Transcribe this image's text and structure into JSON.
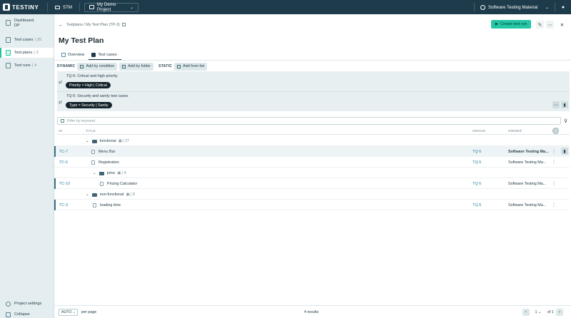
{
  "header": {
    "logo": "TESTINY",
    "workspace": "STM",
    "project": "My Demo Project",
    "organization": "Software Testing Material"
  },
  "sidebar": {
    "items": [
      {
        "label": "Dashboard",
        "sub": "DP",
        "count": ""
      },
      {
        "label": "Test cases",
        "count": "25"
      },
      {
        "label": "Test plans",
        "count": "3"
      },
      {
        "label": "Test runs",
        "count": "4"
      }
    ],
    "project_settings": "Project settings",
    "collapse": "Collapse"
  },
  "breadcrumb": "Testplans / My Test Plan (TP-3)",
  "toolbar": {
    "create_test_run": "Create test run"
  },
  "page_title": "My Test Plan",
  "tabs": [
    {
      "label": "Overview"
    },
    {
      "label": "Test cases"
    }
  ],
  "modes": {
    "dynamic_label": "DYNAMIC",
    "add_by_condition": "Add by condition",
    "add_by_folder": "Add by folder",
    "static_label": "STATIC",
    "add_from_list": "Add from list"
  },
  "conditions": [
    {
      "title": "TQ-5: Critical and high priority",
      "chip": "Priority = High | Critical"
    },
    {
      "title": "TQ-5: Security and sanity test cases",
      "chip": "Type = Security | Sanity"
    }
  ],
  "filter": {
    "placeholder": "Filter by keyword"
  },
  "columns": {
    "id": "ID",
    "title": "TITLE",
    "origin": "ORIGIN",
    "owner": "OWNER"
  },
  "rows": [
    {
      "id": "",
      "title": "functional",
      "count": "27",
      "origin": "",
      "owner": ""
    },
    {
      "id": "TC-7",
      "title": "Menu Bar",
      "origin": "TQ-5",
      "owner": "Software Testing Ma..."
    },
    {
      "id": "TC-6",
      "title": "Registration",
      "origin": "TQ-5",
      "owner": "Software Testing Ma..."
    },
    {
      "id": "",
      "title": "price",
      "count": "4",
      "origin": "",
      "owner": ""
    },
    {
      "id": "TC-10",
      "title": "Pricing Calculator",
      "origin": "TQ-5",
      "owner": "Software Testing Ma..."
    },
    {
      "id": "",
      "title": "non-functional",
      "count": "8",
      "origin": "",
      "owner": ""
    },
    {
      "id": "TC-3",
      "title": "loading time",
      "origin": "TQ-5",
      "owner": "Software Testing Ma..."
    }
  ],
  "footer": {
    "per_page_value": "AUTO",
    "per_page_label": "per page",
    "results": "4 results",
    "page": "1",
    "of": "of 1"
  },
  "colors": {
    "topbar": "#1d3b4a",
    "accent": "#24c6a5",
    "link": "#2a84a8"
  }
}
